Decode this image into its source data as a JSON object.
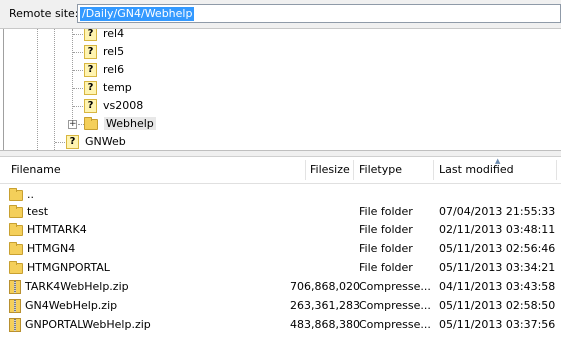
{
  "site": {
    "label": "Remote site:",
    "path": "/Daily/GN4/Webhelp"
  },
  "tree": {
    "children": [
      {
        "label": "rel4",
        "icon": "question-icon"
      },
      {
        "label": "rel5",
        "icon": "question-icon"
      },
      {
        "label": "rel6",
        "icon": "question-icon"
      },
      {
        "label": "temp",
        "icon": "question-icon"
      },
      {
        "label": "vs2008",
        "icon": "question-icon"
      },
      {
        "label": "Webhelp",
        "icon": "folder-icon",
        "expander": "+"
      }
    ],
    "sibling": {
      "label": "GNWeb",
      "icon": "question-icon"
    }
  },
  "list": {
    "columns": {
      "filename": "Filename",
      "filesize": "Filesize",
      "filetype": "Filetype",
      "modified": "Last modified"
    },
    "rows": [
      {
        "name": "..",
        "size": "",
        "type": "",
        "modified": "",
        "icon": "folder-icon"
      },
      {
        "name": "test",
        "size": "",
        "type": "File folder",
        "modified": "07/04/2013 21:55:33",
        "icon": "folder-icon"
      },
      {
        "name": "HTMTARK4",
        "size": "",
        "type": "File folder",
        "modified": "02/11/2013 03:48:11",
        "icon": "folder-icon"
      },
      {
        "name": "HTMGN4",
        "size": "",
        "type": "File folder",
        "modified": "05/11/2013 02:56:46",
        "icon": "folder-icon"
      },
      {
        "name": "HTMGNPORTAL",
        "size": "",
        "type": "File folder",
        "modified": "05/11/2013 03:34:21",
        "icon": "folder-icon"
      },
      {
        "name": "TARK4WebHelp.zip",
        "size": "706,868,020",
        "type": "Compresse...",
        "modified": "04/11/2013 03:43:58",
        "icon": "zip-icon"
      },
      {
        "name": "GN4WebHelp.zip",
        "size": "263,361,283",
        "type": "Compresse...",
        "modified": "05/11/2013 02:58:50",
        "icon": "zip-icon"
      },
      {
        "name": "GNPORTALWebHelp.zip",
        "size": "483,868,380",
        "type": "Compresse...",
        "modified": "05/11/2013 03:37:56",
        "icon": "zip-icon"
      }
    ]
  }
}
